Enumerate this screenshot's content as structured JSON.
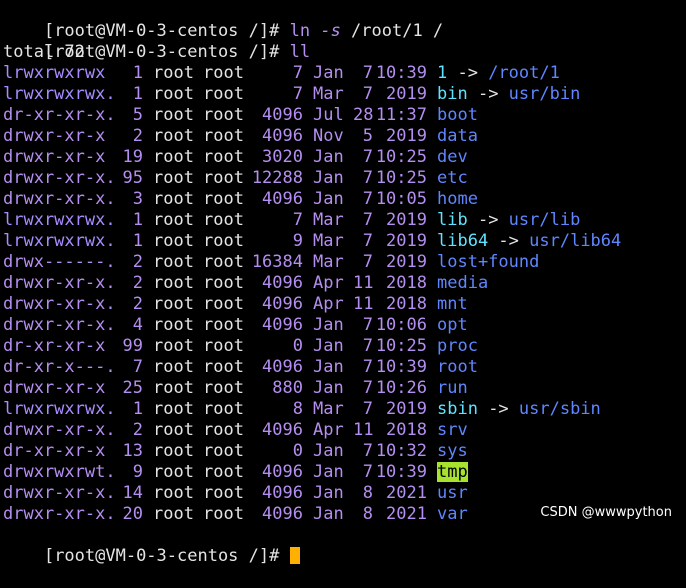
{
  "colors": {
    "background": "#000000",
    "purple": "#b48ef0",
    "dir_blue": "#5f86ff",
    "link_cyan": "#5fe3ff",
    "tmp_bg": "#a6e22e",
    "cursor": "#ffb000"
  },
  "commands": [
    {
      "prompt": "[root@VM-0-3-centos /]# ",
      "cmd": "ln",
      "flag": "-s",
      "args": " /root/1 /"
    },
    {
      "prompt": "[root@VM-0-3-centos /]# ",
      "cmd": "ll",
      "flag": "",
      "args": ""
    }
  ],
  "total": "total 72",
  "entries": [
    {
      "perm": "lrwxrwxrwx",
      "links": "1",
      "owner": "root",
      "group": "root",
      "size": "7",
      "month": "Jan",
      "day": "7",
      "time": "10:39",
      "name": "1",
      "type": "link",
      "target": "/root/1"
    },
    {
      "perm": "lrwxrwxrwx.",
      "links": "1",
      "owner": "root",
      "group": "root",
      "size": "7",
      "month": "Mar",
      "day": "7",
      "time": "2019",
      "name": "bin",
      "type": "link",
      "target": "usr/bin"
    },
    {
      "perm": "dr-xr-xr-x.",
      "links": "5",
      "owner": "root",
      "group": "root",
      "size": "4096",
      "month": "Jul",
      "day": "28",
      "time": "11:37",
      "name": "boot",
      "type": "dir"
    },
    {
      "perm": "drwxr-xr-x",
      "links": "2",
      "owner": "root",
      "group": "root",
      "size": "4096",
      "month": "Nov",
      "day": "5",
      "time": "2019",
      "name": "data",
      "type": "dir"
    },
    {
      "perm": "drwxr-xr-x",
      "links": "19",
      "owner": "root",
      "group": "root",
      "size": "3020",
      "month": "Jan",
      "day": "7",
      "time": "10:25",
      "name": "dev",
      "type": "dir"
    },
    {
      "perm": "drwxr-xr-x.",
      "links": "95",
      "owner": "root",
      "group": "root",
      "size": "12288",
      "month": "Jan",
      "day": "7",
      "time": "10:25",
      "name": "etc",
      "type": "dir"
    },
    {
      "perm": "drwxr-xr-x.",
      "links": "3",
      "owner": "root",
      "group": "root",
      "size": "4096",
      "month": "Jan",
      "day": "7",
      "time": "10:05",
      "name": "home",
      "type": "dir"
    },
    {
      "perm": "lrwxrwxrwx.",
      "links": "1",
      "owner": "root",
      "group": "root",
      "size": "7",
      "month": "Mar",
      "day": "7",
      "time": "2019",
      "name": "lib",
      "type": "link",
      "target": "usr/lib"
    },
    {
      "perm": "lrwxrwxrwx.",
      "links": "1",
      "owner": "root",
      "group": "root",
      "size": "9",
      "month": "Mar",
      "day": "7",
      "time": "2019",
      "name": "lib64",
      "type": "link",
      "target": "usr/lib64"
    },
    {
      "perm": "drwx------.",
      "links": "2",
      "owner": "root",
      "group": "root",
      "size": "16384",
      "month": "Mar",
      "day": "7",
      "time": "2019",
      "name": "lost+found",
      "type": "dir"
    },
    {
      "perm": "drwxr-xr-x.",
      "links": "2",
      "owner": "root",
      "group": "root",
      "size": "4096",
      "month": "Apr",
      "day": "11",
      "time": "2018",
      "name": "media",
      "type": "dir"
    },
    {
      "perm": "drwxr-xr-x.",
      "links": "2",
      "owner": "root",
      "group": "root",
      "size": "4096",
      "month": "Apr",
      "day": "11",
      "time": "2018",
      "name": "mnt",
      "type": "dir"
    },
    {
      "perm": "drwxr-xr-x.",
      "links": "4",
      "owner": "root",
      "group": "root",
      "size": "4096",
      "month": "Jan",
      "day": "7",
      "time": "10:06",
      "name": "opt",
      "type": "dir"
    },
    {
      "perm": "dr-xr-xr-x",
      "links": "99",
      "owner": "root",
      "group": "root",
      "size": "0",
      "month": "Jan",
      "day": "7",
      "time": "10:25",
      "name": "proc",
      "type": "dir"
    },
    {
      "perm": "dr-xr-x---.",
      "links": "7",
      "owner": "root",
      "group": "root",
      "size": "4096",
      "month": "Jan",
      "day": "7",
      "time": "10:39",
      "name": "root",
      "type": "dir"
    },
    {
      "perm": "drwxr-xr-x",
      "links": "25",
      "owner": "root",
      "group": "root",
      "size": "880",
      "month": "Jan",
      "day": "7",
      "time": "10:26",
      "name": "run",
      "type": "dir"
    },
    {
      "perm": "lrwxrwxrwx.",
      "links": "1",
      "owner": "root",
      "group": "root",
      "size": "8",
      "month": "Mar",
      "day": "7",
      "time": "2019",
      "name": "sbin",
      "type": "link",
      "target": "usr/sbin"
    },
    {
      "perm": "drwxr-xr-x.",
      "links": "2",
      "owner": "root",
      "group": "root",
      "size": "4096",
      "month": "Apr",
      "day": "11",
      "time": "2018",
      "name": "srv",
      "type": "dir"
    },
    {
      "perm": "dr-xr-xr-x",
      "links": "13",
      "owner": "root",
      "group": "root",
      "size": "0",
      "month": "Jan",
      "day": "7",
      "time": "10:32",
      "name": "sys",
      "type": "dir"
    },
    {
      "perm": "drwxrwxrwt.",
      "links": "9",
      "owner": "root",
      "group": "root",
      "size": "4096",
      "month": "Jan",
      "day": "7",
      "time": "10:39",
      "name": "tmp",
      "type": "tmp"
    },
    {
      "perm": "drwxr-xr-x.",
      "links": "14",
      "owner": "root",
      "group": "root",
      "size": "4096",
      "month": "Jan",
      "day": "8",
      "time": "2021",
      "name": "usr",
      "type": "dir"
    },
    {
      "perm": "drwxr-xr-x.",
      "links": "20",
      "owner": "root",
      "group": "root",
      "size": "4096",
      "month": "Jan",
      "day": "8",
      "time": "2021",
      "name": "var",
      "type": "dir"
    }
  ],
  "final_prompt": "[root@VM-0-3-centos /]# ",
  "watermark": "CSDN @wwwpython"
}
